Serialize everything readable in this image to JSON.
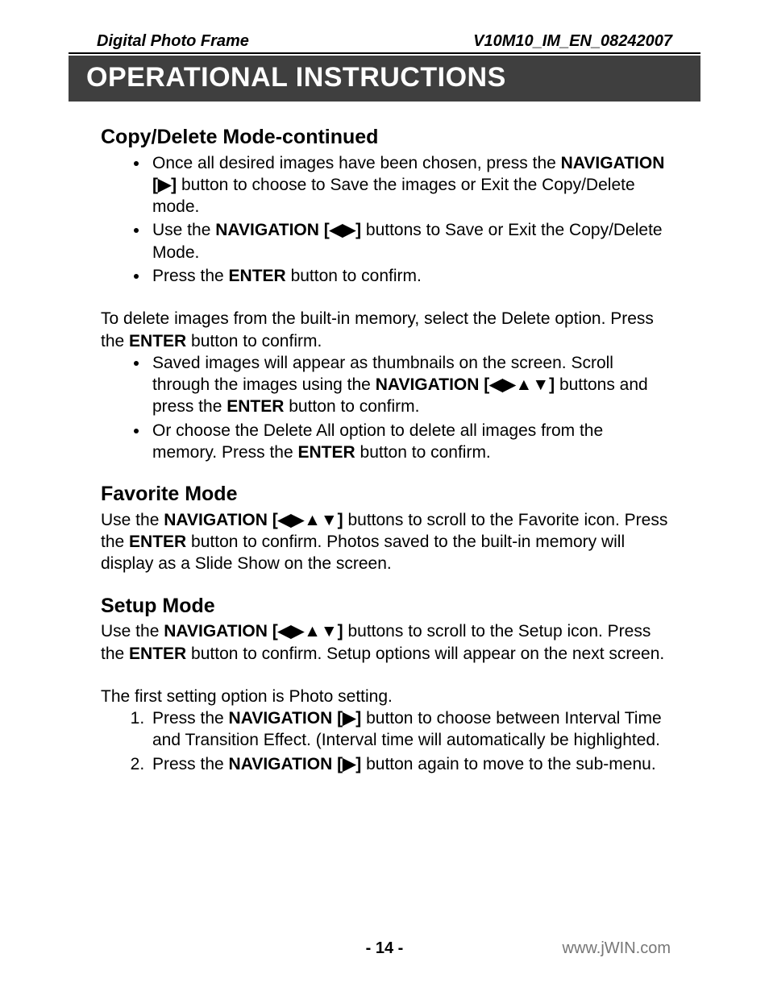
{
  "header": {
    "left": "Digital Photo Frame",
    "right": "V10M10_IM_EN_08242007"
  },
  "banner": "OPERATIONAL INSTRUCTIONS",
  "sections": {
    "copyDelete": {
      "title": "Copy/Delete Mode-continued",
      "bullets1": {
        "b0a": "Once all desired images have been chosen, press the ",
        "b0_nav": "NAVIGATION [▶]",
        "b0b": " button to choose to Save the images or Exit the Copy/Delete mode.",
        "b1a": "Use the ",
        "b1_nav": "NAVIGATION [◀▶]",
        "b1b": " buttons to Save or Exit the Copy/Delete Mode.",
        "b2a": "Press the ",
        "b2_enter": "ENTER",
        "b2b": " button to confirm."
      },
      "para_a": "To delete images from the built-in memory, select the Delete option. Press the ",
      "para_enter": "ENTER",
      "para_b": " button to confirm.",
      "bullets2": {
        "b0a": "Saved images will appear as thumbnails on the screen. Scroll through the images using the ",
        "b0_nav": "NAVIGATION [◀▶▲▼]",
        "b0b": " buttons and press the ",
        "b0_enter": "ENTER",
        "b0c": " button to confirm.",
        "b1a": "Or choose the Delete All option to delete all images from the memory. Press the ",
        "b1_enter": "ENTER",
        "b1b": " button to confirm."
      }
    },
    "favorite": {
      "title": "Favorite Mode",
      "p_a": "Use the ",
      "p_nav": "NAVIGATION [◀▶▲▼]",
      "p_b": " buttons to scroll to the Favorite icon. Press the ",
      "p_enter": "ENTER",
      "p_c": " button to confirm. Photos saved to the built-in memory will display as a Slide Show on the screen."
    },
    "setup": {
      "title": "Setup Mode",
      "p1_a": "Use the ",
      "p1_nav": "NAVIGATION [◀▶▲▼]",
      "p1_b": " buttons to scroll to the Setup icon. Press the ",
      "p1_enter": "ENTER",
      "p1_c": " button to confirm. Setup options will appear on the next screen.",
      "p2": "The first setting option is Photo setting.",
      "ol": {
        "o0a": "Press the ",
        "o0_nav": "NAVIGATION [▶]",
        "o0b": " button to choose between Interval Time and Transition Effect. (Interval time will automatically be highlighted.",
        "o1a": "Press the ",
        "o1_nav": "NAVIGATION [▶]",
        "o1b": " button again to move to the sub-menu."
      }
    }
  },
  "footer": {
    "page": "- 14 -",
    "url": "www.jWIN.com"
  }
}
